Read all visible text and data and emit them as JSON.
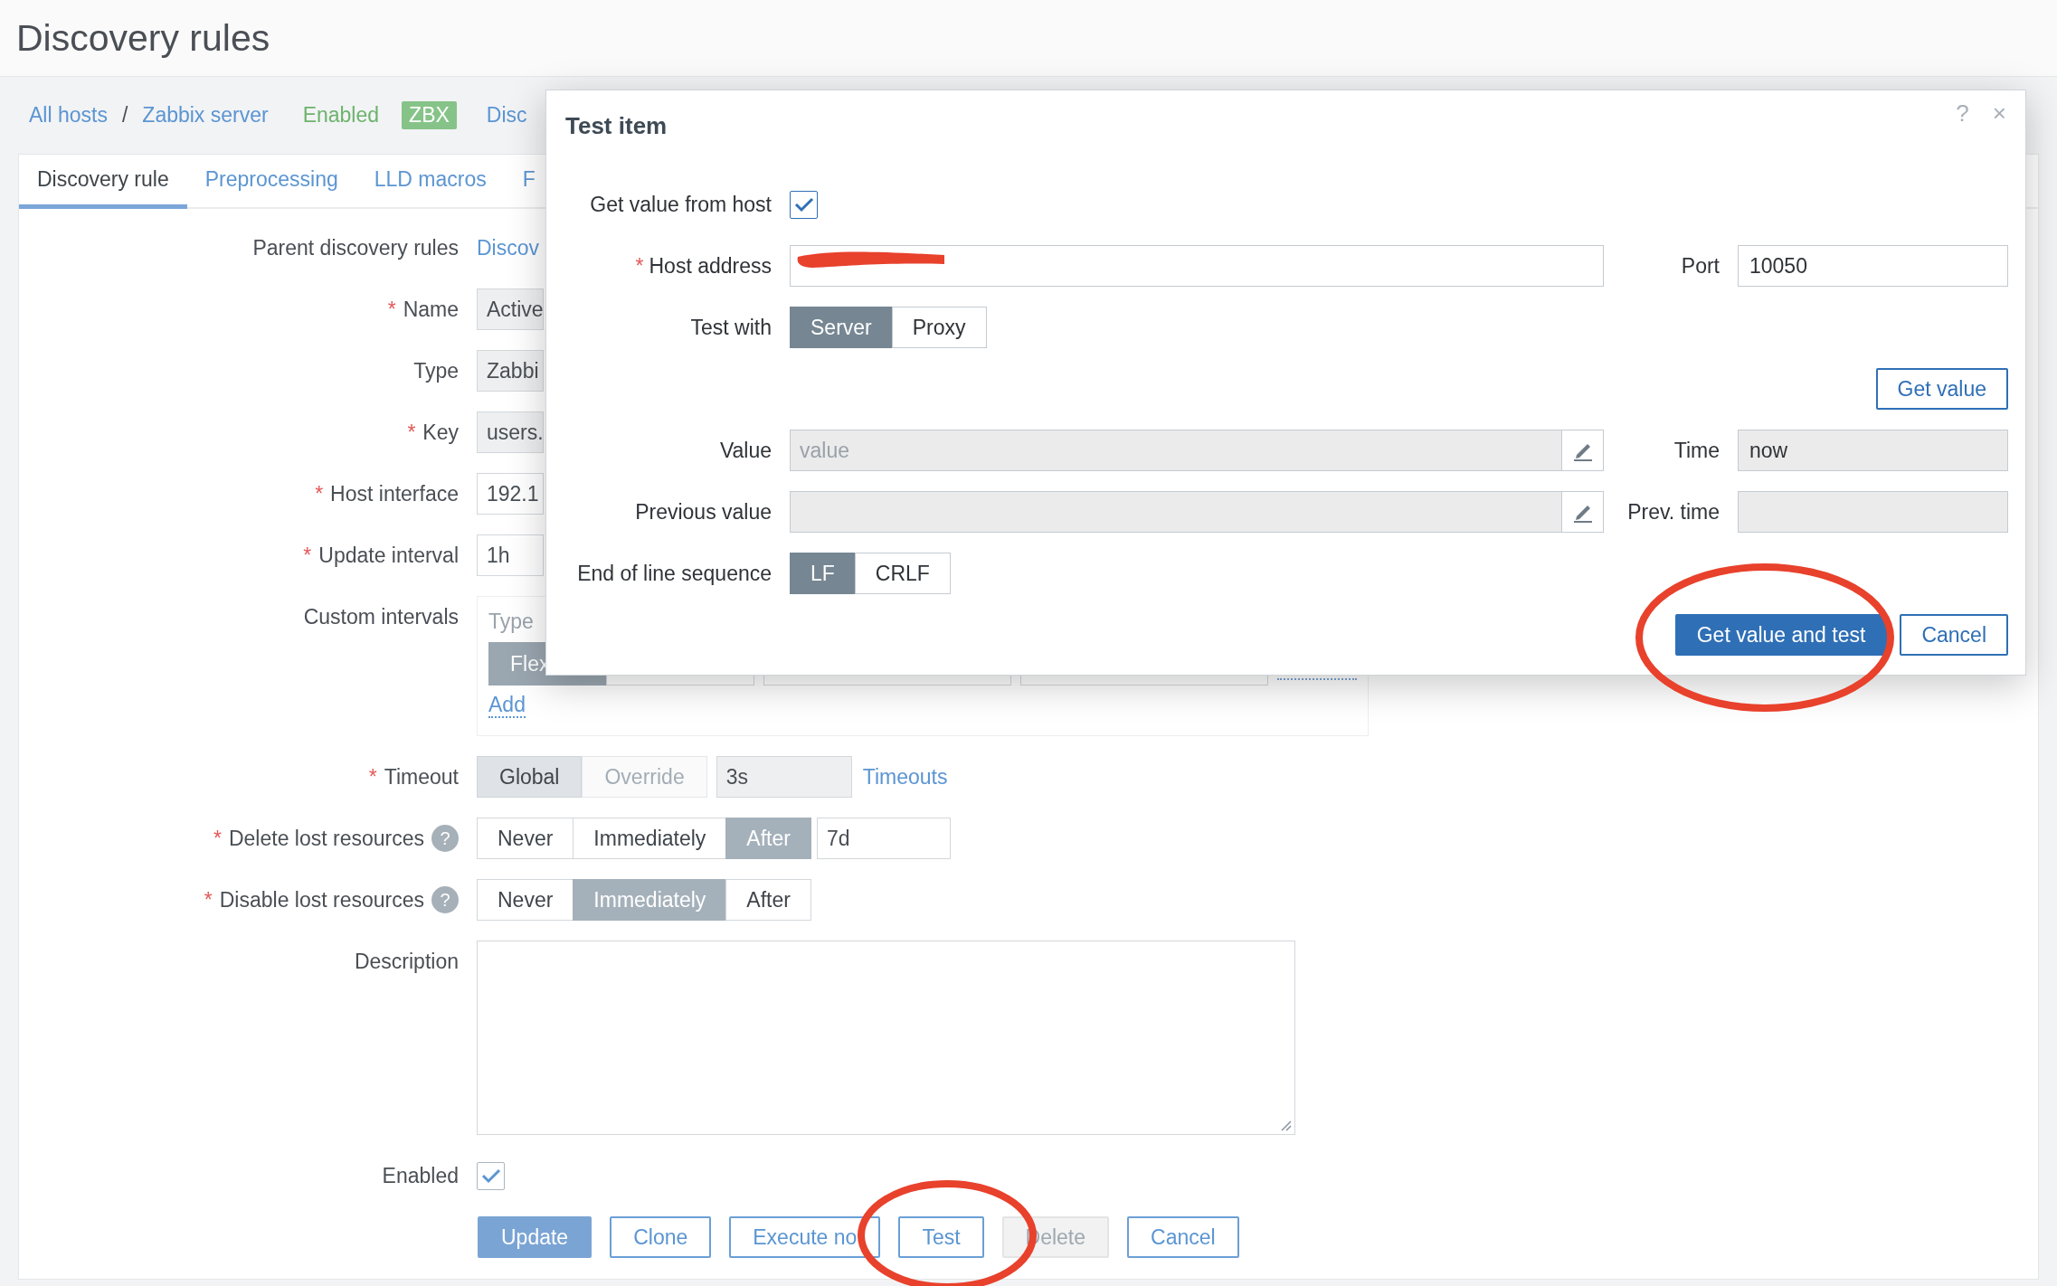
{
  "page_title": "Discovery rules",
  "breadcrumbs": {
    "items": [
      {
        "label": "All hosts"
      },
      {
        "label": "Zabbix server"
      }
    ],
    "separator": "/",
    "status": "Enabled",
    "badge": "ZBX",
    "tail": "Disc"
  },
  "tabs": [
    {
      "label": "Discovery rule",
      "selected": true
    },
    {
      "label": "Preprocessing",
      "selected": false
    },
    {
      "label": "LLD macros",
      "selected": false
    },
    {
      "label": "F",
      "selected": false
    }
  ],
  "form": {
    "rows": [
      {
        "kind": "link",
        "label": "Parent discovery rules",
        "value": "Discov"
      },
      {
        "kind": "field",
        "label": "Name",
        "required_mark": "*",
        "value": "Active",
        "readonly": true
      },
      {
        "kind": "field",
        "label": "Type",
        "value": "Zabbi",
        "readonly": true
      },
      {
        "kind": "field",
        "label": "Key",
        "required_mark": "*",
        "value": "users.",
        "readonly": true
      },
      {
        "kind": "field",
        "label": "Host interface",
        "required_mark": "*",
        "value": "192.1",
        "readonly": false
      },
      {
        "kind": "field",
        "label": "Update interval",
        "required_mark": "*",
        "value": "1h",
        "readonly": false
      },
      {
        "kind": "intervals",
        "label": "Custom intervals",
        "header": "Type",
        "mode": "Flex",
        "add_link": "Add"
      },
      {
        "kind": "timeout",
        "label": "Timeout",
        "required_mark": "*",
        "options": [
          {
            "label": "Global",
            "selected": true,
            "disabled": false
          },
          {
            "label": "Override",
            "selected": false,
            "disabled": true
          }
        ],
        "value": "3s",
        "link": "Timeouts"
      },
      {
        "kind": "segmented",
        "label": "Delete lost resources",
        "required_mark": "*",
        "help": "?",
        "options": [
          {
            "label": "Never",
            "selected": false
          },
          {
            "label": "Immediately",
            "selected": false
          },
          {
            "label": "After",
            "selected": true
          }
        ],
        "value": "7d"
      },
      {
        "kind": "segmented",
        "label": "Disable lost resources",
        "required_mark": "*",
        "help": "?",
        "options": [
          {
            "label": "Never",
            "selected": false
          },
          {
            "label": "Immediately",
            "selected": true
          },
          {
            "label": "After",
            "selected": false
          }
        ]
      },
      {
        "kind": "textarea",
        "label": "Description"
      },
      {
        "kind": "checkbox",
        "label": "Enabled",
        "checked": true
      }
    ],
    "buttons": [
      {
        "label": "Update",
        "primary": true,
        "disabled": false
      },
      {
        "label": "Clone",
        "primary": false,
        "disabled": false
      },
      {
        "label": "Execute no",
        "primary": false,
        "disabled": false
      },
      {
        "label": "Test",
        "primary": false,
        "disabled": false
      },
      {
        "label": "Delete",
        "primary": false,
        "disabled": true
      },
      {
        "label": "Cancel",
        "primary": false,
        "disabled": false
      }
    ]
  },
  "dialog": {
    "title": "Test item",
    "help": "?",
    "close": "×",
    "get_value_from_host": {
      "label": "Get value from host",
      "checked": true
    },
    "host_address": {
      "label": "Host address",
      "required_mark": "*"
    },
    "port": {
      "label": "Port",
      "value": "10050"
    },
    "test_with": {
      "label": "Test with",
      "options": [
        {
          "label": "Server",
          "selected": true
        },
        {
          "label": "Proxy",
          "selected": false
        }
      ]
    },
    "get_value_button": "Get value",
    "value": {
      "label": "Value",
      "placeholder": "value"
    },
    "time": {
      "label": "Time",
      "value": "now"
    },
    "previous_value": {
      "label": "Previous value"
    },
    "prev_time": {
      "label": "Prev. time"
    },
    "eol": {
      "label": "End of line sequence",
      "options": [
        {
          "label": "LF",
          "selected": true
        },
        {
          "label": "CRLF",
          "selected": false
        }
      ]
    },
    "buttons": [
      {
        "label": "Get value and test",
        "primary": true
      },
      {
        "label": "Cancel",
        "primary": false
      }
    ]
  }
}
